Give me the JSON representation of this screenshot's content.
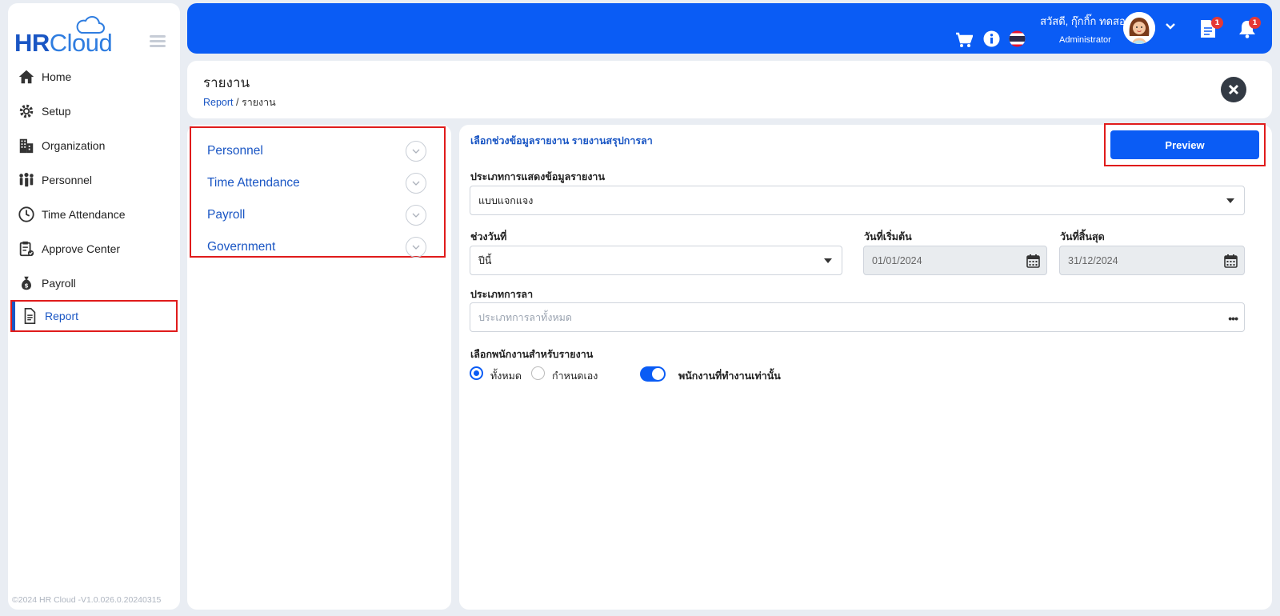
{
  "brand": {
    "hr": "HR",
    "cloud": "Cloud"
  },
  "sidebar": {
    "items": [
      {
        "label": "Home",
        "icon": "home-icon"
      },
      {
        "label": "Setup",
        "icon": "gear-icon"
      },
      {
        "label": "Organization",
        "icon": "building-icon"
      },
      {
        "label": "Personnel",
        "icon": "people-icon"
      },
      {
        "label": "Time Attendance",
        "icon": "clock-icon"
      },
      {
        "label": "Approve Center",
        "icon": "clipboard-check-icon"
      },
      {
        "label": "Payroll",
        "icon": "money-bag-icon"
      },
      {
        "label": "Report",
        "icon": "document-icon",
        "active": true
      }
    ],
    "version": "©2024 HR Cloud -V1.0.026.0.20240315"
  },
  "topbar": {
    "greeting": "สวัสดี, กุ๊กกิ๊ก ทดสอบ",
    "role": "Administrator",
    "doc_badge": "1",
    "bell_badge": "1",
    "accent": "#0a5cf5"
  },
  "header": {
    "title": "รายงาน",
    "breadcrumb_link": "Report",
    "breadcrumb_sep": "/",
    "breadcrumb_current": "รายงาน"
  },
  "categories": [
    "Personnel",
    "Time Attendance",
    "Payroll",
    "Government"
  ],
  "form": {
    "section_title": "เลือกช่วงข้อมูลรายงาน รายงานสรุปการลา",
    "preview_label": "Preview",
    "display_type_label": "ประเภทการแสดงข้อมูลรายงาน",
    "display_type_value": "แบบแจกแจง",
    "date_range_label": "ช่วงวันที่",
    "date_range_value": "ปีนี้",
    "start_label": "วันที่เริ่มต้น",
    "start_value": "01/01/2024",
    "end_label": "วันที่สิ้นสุด",
    "end_value": "31/12/2024",
    "leave_type_label": "ประเภทการลา",
    "leave_type_placeholder": "ประเภทการลาทั้งหมด",
    "employee_label": "เลือกพนักงานสำหรับรายงาน",
    "radio_all": "ทั้งหมด",
    "radio_custom": "กำหนดเอง",
    "toggle_label": "พนักงานที่ทำงานเท่านั้น"
  }
}
